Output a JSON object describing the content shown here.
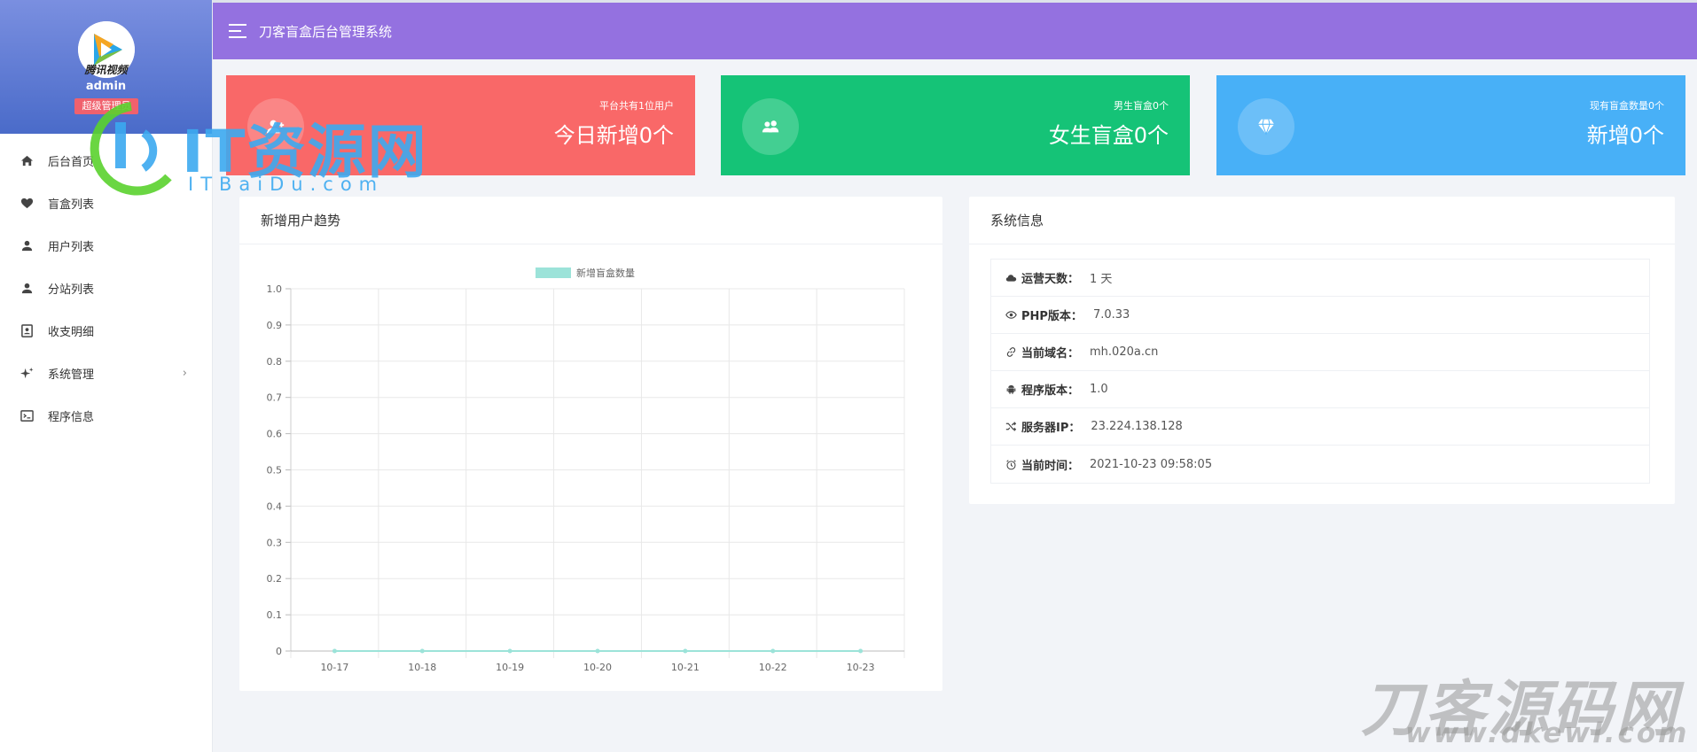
{
  "header": {
    "title": "刀客盲盒后台管理系统"
  },
  "profile": {
    "avatar_caption": "腾讯视频",
    "username": "admin",
    "role": "超级管理员"
  },
  "sidebar": {
    "items": [
      {
        "label": "后台首页",
        "icon": "home-icon"
      },
      {
        "label": "盲盒列表",
        "icon": "heart-icon"
      },
      {
        "label": "用户列表",
        "icon": "user-icon"
      },
      {
        "label": "分站列表",
        "icon": "user-icon"
      },
      {
        "label": "收支明细",
        "icon": "contact-book-icon"
      },
      {
        "label": "系统管理",
        "icon": "sparkle-icon",
        "has_submenu": true
      },
      {
        "label": "程序信息",
        "icon": "terminal-icon"
      }
    ]
  },
  "cards": [
    {
      "small": "平台共有1位用户",
      "big": "今日新增0个",
      "color": "#f96868",
      "icon": "user-add-icon"
    },
    {
      "small": "男生盲盒0个",
      "big": "女生盲盒0个",
      "color": "#15c377",
      "icon": "users-icon"
    },
    {
      "small": "现有盲盒数量0个",
      "big": "新增0个",
      "color": "#48b0f7",
      "icon": "diamond-icon"
    }
  ],
  "chart_panel": {
    "title": "新增用户趋势"
  },
  "chart_data": {
    "type": "line",
    "categories": [
      "10-17",
      "10-18",
      "10-19",
      "10-20",
      "10-21",
      "10-22",
      "10-23"
    ],
    "series": [
      {
        "name": "新增盲盒数量",
        "values": [
          0,
          0,
          0,
          0,
          0,
          0,
          0
        ],
        "color": "#9ce3d9"
      }
    ],
    "ylim": [
      0,
      1.0
    ],
    "yticks": [
      "1.0",
      "0.9",
      "0.8",
      "0.7",
      "0.6",
      "0.5",
      "0.4",
      "0.3",
      "0.2",
      "0.1",
      "0"
    ],
    "grid": true,
    "legend": "top-center"
  },
  "info_panel": {
    "title": "系统信息",
    "rows": [
      {
        "label": "运营天数：",
        "value": "1 天",
        "icon": "cloud-icon"
      },
      {
        "label": "PHP版本：",
        "value": "7.0.33",
        "icon": "eye-icon"
      },
      {
        "label": "当前域名：",
        "value": "mh.020a.cn",
        "icon": "link-icon"
      },
      {
        "label": "程序版本：",
        "value": "1.0",
        "icon": "android-icon"
      },
      {
        "label": "服务器IP：",
        "value": "23.224.138.128",
        "icon": "shuffle-icon"
      },
      {
        "label": "当前时间：",
        "value": "2021-10-23 09:58:05",
        "icon": "alarm-icon"
      }
    ]
  },
  "watermarks": {
    "itbaidu_title": "IT资源网",
    "itbaidu_sub": "ITBaiDu.com",
    "dkewl_title": "刀客源码网",
    "dkewl_sub": "www.dkewl.com"
  }
}
